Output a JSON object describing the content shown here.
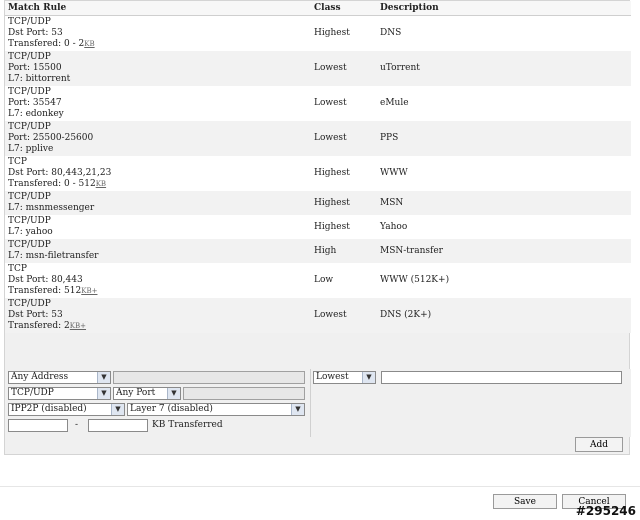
{
  "headers": {
    "match_rule": "Match Rule",
    "class": "Class",
    "description": "Description"
  },
  "rules": [
    {
      "lines": [
        "TCP/UDP",
        "Dst Port: 53",
        "Transfered: 0 - 2"
      ],
      "unit": "KB",
      "class": "Highest",
      "description": "DNS"
    },
    {
      "lines": [
        "TCP/UDP",
        "Port: 15500",
        "L7: bittorrent"
      ],
      "class": "Lowest",
      "description": "uTorrent"
    },
    {
      "lines": [
        "TCP/UDP",
        "Port: 35547",
        "L7: edonkey"
      ],
      "class": "Lowest",
      "description": "eMule"
    },
    {
      "lines": [
        "TCP/UDP",
        "Port: 25500-25600",
        "L7: pplive"
      ],
      "class": "Lowest",
      "description": "PPS"
    },
    {
      "lines": [
        "TCP",
        "Dst Port: 80,443,21,23",
        "Transfered: 0 - 512"
      ],
      "unit": "KB",
      "class": "Highest",
      "description": "WWW"
    },
    {
      "lines": [
        "TCP/UDP",
        "L7: msnmessenger"
      ],
      "class": "Highest",
      "description": "MSN"
    },
    {
      "lines": [
        "TCP/UDP",
        "L7: yahoo"
      ],
      "class": "Highest",
      "description": "Yahoo"
    },
    {
      "lines": [
        "TCP/UDP",
        "L7: msn-filetransfer"
      ],
      "class": "High",
      "description": "MSN-transfer"
    },
    {
      "lines": [
        "TCP",
        "Dst Port: 80,443",
        "Transfered: 512"
      ],
      "unit": "KB+",
      "class": "Low",
      "description": "WWW (512K+)"
    },
    {
      "lines": [
        "TCP/UDP",
        "Dst Port: 53",
        "Transfered: 2"
      ],
      "unit": "KB+",
      "class": "Lowest",
      "description": "DNS (2K+)"
    }
  ],
  "form": {
    "address_select": "Any Address",
    "protocol_select": "TCP/UDP",
    "port_select": "Any Port",
    "ipp2p_select": "IPP2P (disabled)",
    "layer7_select": "Layer 7 (disabled)",
    "range_separator": "-",
    "kb_label": "KB Transferred",
    "class_select": "Lowest",
    "add_label": "Add"
  },
  "footer": {
    "save_label": "Save",
    "cancel_label": "Cancel"
  },
  "watermark": "#295246"
}
